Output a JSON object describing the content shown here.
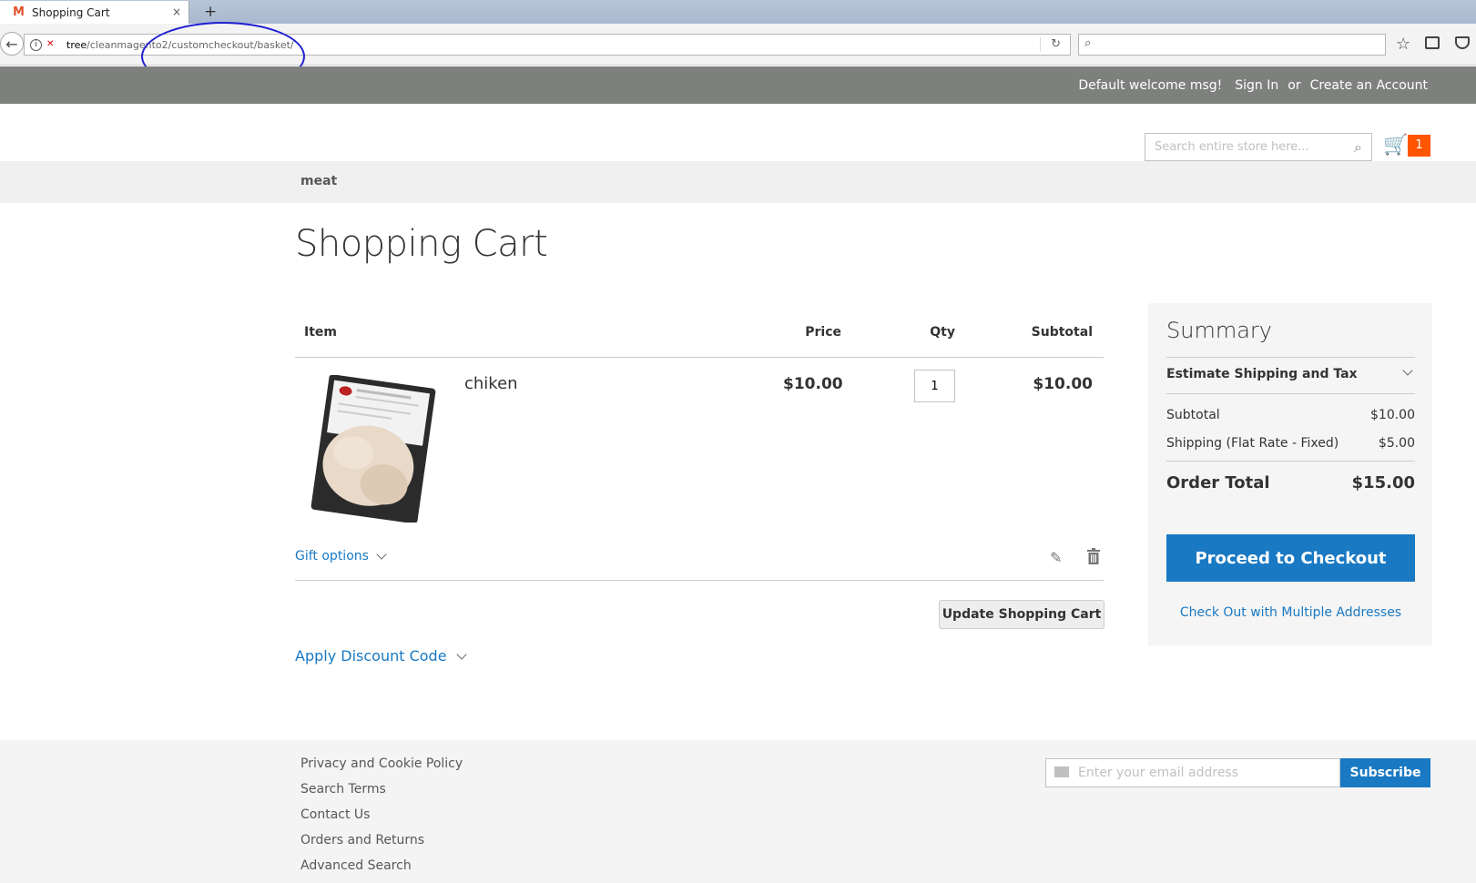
{
  "browser": {
    "tab_title": "Shopping Cart",
    "tab_close": "×",
    "new_tab": "+",
    "url_host": "tree",
    "url_path": "/cleanmagento2/customcheckout/basket/"
  },
  "header": {
    "welcome": "Default welcome msg!",
    "sign_in": "Sign In",
    "or": "or",
    "create_account": "Create an Account"
  },
  "search": {
    "placeholder": "Search entire store here..."
  },
  "minicart": {
    "count": "1"
  },
  "nav": {
    "item": "meat"
  },
  "page": {
    "title": "Shopping Cart"
  },
  "cart": {
    "columns": {
      "item": "Item",
      "price": "Price",
      "qty": "Qty",
      "subtotal": "Subtotal"
    },
    "items": [
      {
        "name": "chiken",
        "price": "$10.00",
        "qty": "1",
        "subtotal": "$10.00"
      }
    ],
    "gift_options": "Gift options",
    "update_button": "Update Shopping Cart",
    "discount": "Apply Discount Code"
  },
  "summary": {
    "title": "Summary",
    "estimate": "Estimate Shipping and Tax",
    "subtotal_label": "Subtotal",
    "subtotal_value": "$10.00",
    "shipping_label": "Shipping (Flat Rate - Fixed)",
    "shipping_value": "$5.00",
    "total_label": "Order Total",
    "total_value": "$15.00",
    "checkout_button": "Proceed to Checkout",
    "multi_address": "Check Out with Multiple Addresses"
  },
  "footer": {
    "links": [
      "Privacy and Cookie Policy",
      "Search Terms",
      "Contact Us",
      "Orders and Returns",
      "Advanced Search"
    ],
    "newsletter_placeholder": "Enter your email address",
    "subscribe": "Subscribe"
  },
  "colors": {
    "accent": "#1979c3",
    "cart_badge": "#ff5501",
    "header_bg": "#7e807e",
    "annotation": "#1f1fd0"
  }
}
